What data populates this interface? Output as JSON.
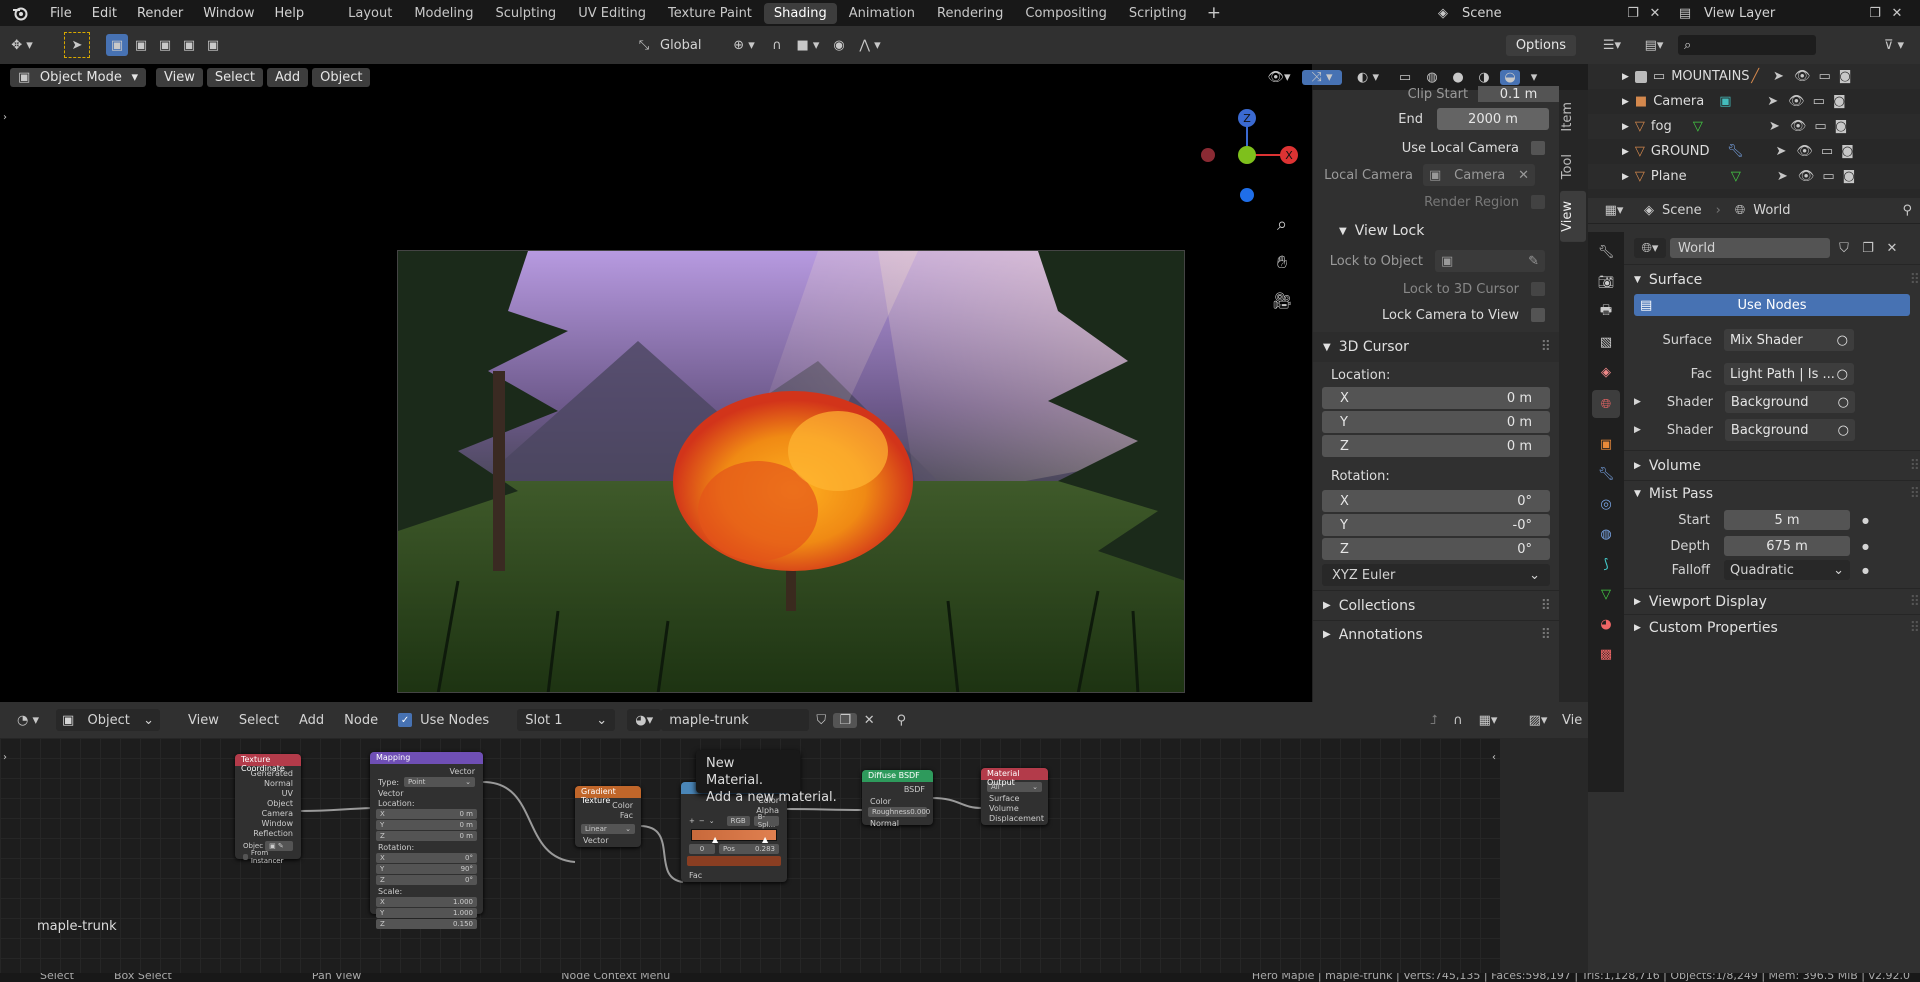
{
  "topbar": {
    "menus": [
      "File",
      "Edit",
      "Render",
      "Window",
      "Help"
    ],
    "workspaces": [
      "Layout",
      "Modeling",
      "Sculpting",
      "UV Editing",
      "Texture Paint",
      "Shading",
      "Animation",
      "Rendering",
      "Compositing",
      "Scripting"
    ],
    "active_workspace": "Shading",
    "scene": "Scene",
    "view_layer": "View Layer"
  },
  "toolbar": {
    "orientation": "Global",
    "options": "Options"
  },
  "viewport": {
    "mode": "Object Mode",
    "menus": [
      "View",
      "Select",
      "Add",
      "Object"
    ],
    "axes": {
      "z": "Z",
      "x": "X"
    }
  },
  "npanel": {
    "clip_start_label": "Clip Start",
    "clip_start_value": "0.1 m",
    "end_label": "End",
    "end_value": "2000 m",
    "use_local_camera": "Use Local Camera",
    "local_camera_label": "Local Camera",
    "local_camera_value": "Camera",
    "render_region": "Render Region",
    "view_lock": "View Lock",
    "lock_to_object": "Lock to Object",
    "lock_to_cursor": "Lock to 3D Cursor",
    "lock_camera": "Lock Camera to View",
    "cursor_title": "3D Cursor",
    "location_label": "Location:",
    "loc": [
      {
        "axis": "X",
        "val": "0 m"
      },
      {
        "axis": "Y",
        "val": "0 m"
      },
      {
        "axis": "Z",
        "val": "0 m"
      }
    ],
    "rotation_label": "Rotation:",
    "rot": [
      {
        "axis": "X",
        "val": "0°"
      },
      {
        "axis": "Y",
        "val": "-0°"
      },
      {
        "axis": "Z",
        "val": "0°"
      }
    ],
    "rot_mode": "XYZ Euler",
    "collections": "Collections",
    "annotations": "Annotations",
    "tabs": [
      "Item",
      "Tool",
      "View"
    ],
    "active_tab": "View"
  },
  "outliner": {
    "items": [
      {
        "name": "MOUNTAINS",
        "color": "#d4884d"
      },
      {
        "name": "Camera",
        "color": "#d4884d"
      },
      {
        "name": "fog",
        "color": "#d4884d"
      },
      {
        "name": "GROUND",
        "color": "#d4884d"
      },
      {
        "name": "Plane",
        "color": "#d4884d"
      }
    ]
  },
  "properties": {
    "breadcrumb_scene": "Scene",
    "breadcrumb_world": "World",
    "world_name": "World",
    "surface_title": "Surface",
    "use_nodes": "Use Nodes",
    "surface_label": "Surface",
    "surface_value": "Mix Shader",
    "fac_label": "Fac",
    "fac_value": "Light Path | Is ...",
    "shader1_label": "Shader",
    "shader1_value": "Background",
    "shader2_label": "Shader",
    "shader2_value": "Background",
    "volume": "Volume",
    "mist": "Mist Pass",
    "start_label": "Start",
    "start_value": "5 m",
    "depth_label": "Depth",
    "depth_value": "675 m",
    "falloff_label": "Falloff",
    "falloff_value": "Quadratic",
    "viewport_display": "Viewport Display",
    "custom_props": "Custom Properties"
  },
  "node_editor": {
    "mode": "Object",
    "menus": [
      "View",
      "Select",
      "Add",
      "Node"
    ],
    "use_nodes": "Use Nodes",
    "slot": "Slot 1",
    "material": "maple-trunk",
    "side_label": "Vie",
    "material_label": "maple-trunk",
    "tooltip_title": "New Material.",
    "tooltip_desc": "Add a new material.",
    "nodes": {
      "texcoord": {
        "title": "Texture Coordinate",
        "outputs": [
          "Generated",
          "Normal",
          "UV",
          "Object",
          "Camera",
          "Window",
          "Reflection"
        ],
        "object_label": "Objec",
        "instancer": "From Instancer"
      },
      "mapping": {
        "title": "Mapping",
        "out": "Vector",
        "type_label": "Type:",
        "type_value": "Point",
        "vector": "Vector",
        "location": "Location:",
        "loc": [
          [
            "X",
            "0 m"
          ],
          [
            "Y",
            "0 m"
          ],
          [
            "Z",
            "0 m"
          ]
        ],
        "rotation": "Rotation:",
        "rot": [
          [
            "X",
            "0°"
          ],
          [
            "Y",
            "90°"
          ],
          [
            "Z",
            "0°"
          ]
        ],
        "scale": "Scale:",
        "scl": [
          [
            "X",
            "1.000"
          ],
          [
            "Y",
            "1.000"
          ],
          [
            "Z",
            "0.150"
          ]
        ]
      },
      "gradient": {
        "title": "Gradient Texture",
        "outputs": [
          "Color",
          "Fac"
        ],
        "mode": "Linear",
        "input": "Vector"
      },
      "ramp": {
        "outputs": [
          "Color",
          "Alpha"
        ],
        "color_mode": "RGB",
        "interp": "B-Spl...",
        "index": "0",
        "pos_label": "Pos",
        "pos_value": "0.283",
        "input": "Fac"
      },
      "diffuse": {
        "title": "Diffuse BSDF",
        "out": "BSDF",
        "inputs": [
          "Color",
          "Roughness",
          "Normal"
        ],
        "roughness": "0.000"
      },
      "output": {
        "title": "Material Output",
        "target": "All",
        "inputs": [
          "Surface",
          "Volume",
          "Displacement"
        ]
      }
    }
  },
  "status": {
    "left": [
      "Select",
      "Box Select",
      "Pan View",
      "Node Context Menu"
    ],
    "right": "Hero Maple | maple-trunk | Verts:745,135 | Faces:598,197 | Tris:1,128,716 | Objects:1/8,249 | Mem: 396.5 MiB | v2.92.0"
  }
}
